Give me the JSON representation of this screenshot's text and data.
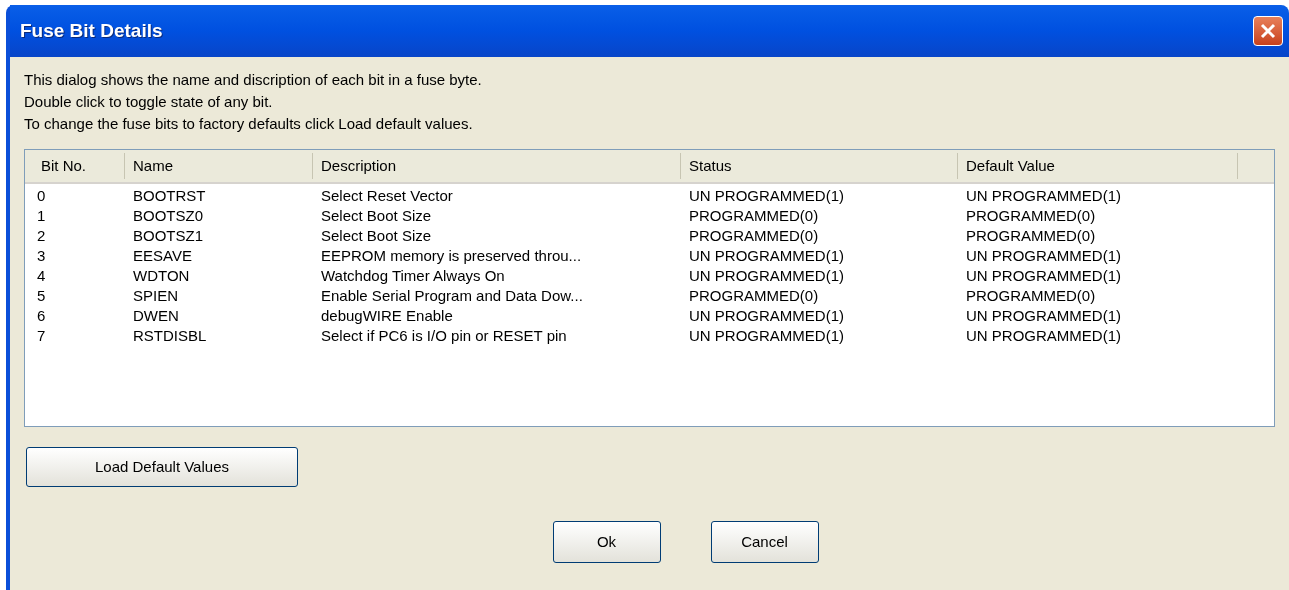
{
  "window": {
    "title": "Fuse Bit Details"
  },
  "intro": [
    "This dialog shows the name and discription of each bit in a fuse byte.",
    "Double click to toggle state of any bit.",
    "To change the fuse bits to factory defaults click Load default values."
  ],
  "table": {
    "columns": [
      "Bit No.",
      "Name",
      "Description",
      "Status",
      "Default Value"
    ],
    "rows": [
      [
        "0",
        "BOOTRST",
        "Select Reset Vector",
        "UN PROGRAMMED(1)",
        "UN PROGRAMMED(1)"
      ],
      [
        "1",
        "BOOTSZ0",
        "Select Boot Size",
        "PROGRAMMED(0)",
        "PROGRAMMED(0)"
      ],
      [
        "2",
        "BOOTSZ1",
        "Select Boot Size",
        "PROGRAMMED(0)",
        "PROGRAMMED(0)"
      ],
      [
        "3",
        "EESAVE",
        "EEPROM memory is preserved throu...",
        "UN PROGRAMMED(1)",
        "UN PROGRAMMED(1)"
      ],
      [
        "4",
        "WDTON",
        "Watchdog Timer Always On",
        "UN PROGRAMMED(1)",
        "UN PROGRAMMED(1)"
      ],
      [
        "5",
        "SPIEN",
        "Enable Serial Program and Data Dow...",
        "PROGRAMMED(0)",
        "PROGRAMMED(0)"
      ],
      [
        "6",
        "DWEN",
        "debugWIRE Enable",
        "UN PROGRAMMED(1)",
        "UN PROGRAMMED(1)"
      ],
      [
        "7",
        "RSTDISBL",
        "Select if PC6 is I/O pin or RESET pin",
        "UN PROGRAMMED(1)",
        "UN PROGRAMMED(1)"
      ]
    ]
  },
  "load_button": "Load Default Values",
  "buttons": [
    "Ok",
    "Cancel"
  ]
}
